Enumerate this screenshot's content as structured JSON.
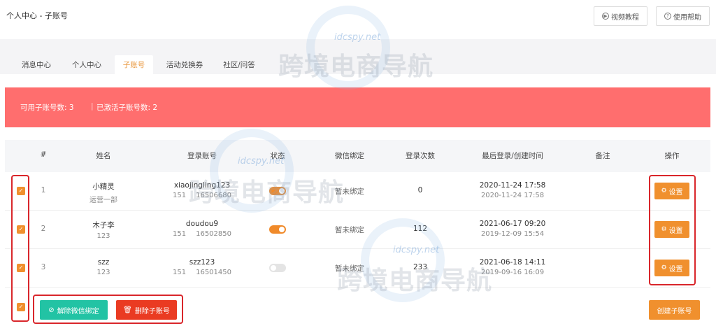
{
  "header": {
    "title": "个人中心 - 子账号",
    "video_label": "视频教程",
    "help_label": "使用帮助"
  },
  "tabs": [
    {
      "label": "消息中心",
      "active": false
    },
    {
      "label": "个人中心",
      "active": false
    },
    {
      "label": "子账号",
      "active": true
    },
    {
      "label": "活动兑换券",
      "active": false
    },
    {
      "label": "社区/问答",
      "active": false
    }
  ],
  "banner": {
    "available": "可用子账号数: 3",
    "separator": "|",
    "activated": "已激活子账号数: 2",
    "color": "#ff6e6e"
  },
  "table": {
    "columns": [
      "#",
      "姓名",
      "登录账号",
      "状态",
      "微信绑定",
      "登录次数",
      "最后登录/创建时间",
      "备注",
      "操作"
    ],
    "rows": [
      {
        "index": "1",
        "name": "小精灵",
        "dept": "运营一部",
        "account": "xiaojingling123",
        "phone_prefix": "151",
        "phone_suffix": "16506680",
        "status_on": true,
        "wechat": "暂未绑定",
        "logins": "0",
        "last_login": "2020-11-24 17:58",
        "created": "2020-11-24 17:58",
        "remark": "",
        "action": "设置"
      },
      {
        "index": "2",
        "name": "木子李",
        "dept": "123",
        "account": "doudou9",
        "phone_prefix": "151",
        "phone_suffix": "16502850",
        "status_on": true,
        "wechat": "暂未绑定",
        "logins": "112",
        "last_login": "2021-06-17 09:20",
        "created": "2019-12-09 15:54",
        "remark": "",
        "action": "设置"
      },
      {
        "index": "3",
        "name": "szz",
        "dept": "123",
        "account": "szz123",
        "phone_prefix": "151",
        "phone_suffix": "16501450",
        "status_on": false,
        "wechat": "暂未绑定",
        "logins": "233",
        "last_login": "2021-06-18 14:11",
        "created": "2019-09-16 16:09",
        "remark": "",
        "action": "设置"
      }
    ]
  },
  "footer": {
    "unbind_label": "解除微信绑定",
    "delete_label": "删除子账号",
    "create_label": "创建子账号"
  },
  "watermark": {
    "domain": "idcspy.net",
    "text": "跨境电商导航"
  },
  "colors": {
    "accent": "#f0902e",
    "teal": "#22c3a4",
    "danger": "#ea3b22",
    "highlight_frame": "#d9262b"
  }
}
